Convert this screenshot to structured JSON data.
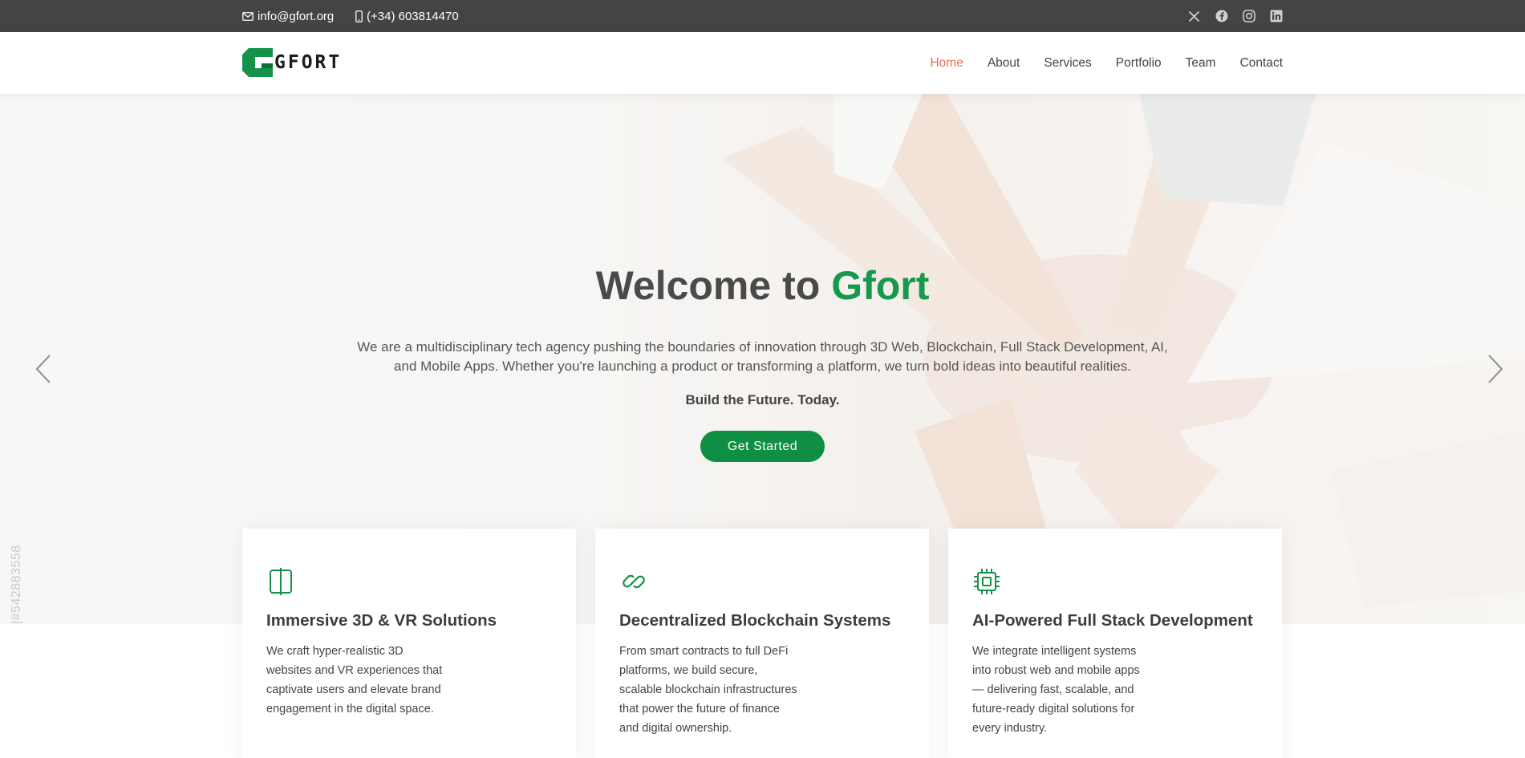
{
  "topbar": {
    "email": "info@gfort.org",
    "phone": "(+34) 603814470",
    "social": [
      "x-icon",
      "facebook-icon",
      "instagram-icon",
      "linkedin-icon"
    ]
  },
  "header": {
    "logo_text": "GFORT",
    "nav": [
      {
        "label": "Home",
        "active": true
      },
      {
        "label": "About",
        "active": false
      },
      {
        "label": "Services",
        "active": false
      },
      {
        "label": "Portfolio",
        "active": false
      },
      {
        "label": "Team",
        "active": false
      },
      {
        "label": "Contact",
        "active": false
      }
    ]
  },
  "hero": {
    "title_prefix": "Welcome to ",
    "title_brand": "Gfort",
    "description": "We are a multidisciplinary tech agency pushing the boundaries of innovation through 3D Web, Blockchain, Full Stack Development, AI, and Mobile Apps. Whether you're launching a product or transforming a platform, we turn bold ideas into beautiful realities.",
    "tagline": "Build the Future. Today.",
    "cta": "Get Started",
    "watermark": "|#542883558"
  },
  "cards": [
    {
      "icon": "vr-split-icon",
      "title": "Immersive 3D & VR Solutions",
      "text": "We craft hyper-realistic 3D websites and VR experiences that captivate users and elevate brand engagement in the digital space."
    },
    {
      "icon": "chain-link-icon",
      "title": "Decentralized Blockchain Systems",
      "text": "From smart contracts to full DeFi platforms, we build secure, scalable blockchain infrastructures that power the future of finance and digital ownership."
    },
    {
      "icon": "cpu-chip-icon",
      "title": "AI-Powered Full Stack Development",
      "text": "We integrate intelligent systems into robust web and mobile apps — delivering fast, scalable, and future-ready digital solutions for every industry."
    }
  ],
  "colors": {
    "topbar": "#444444",
    "accent_green": "#16994c",
    "button_green": "#0f8f43",
    "nav_active": "#e96b56"
  }
}
